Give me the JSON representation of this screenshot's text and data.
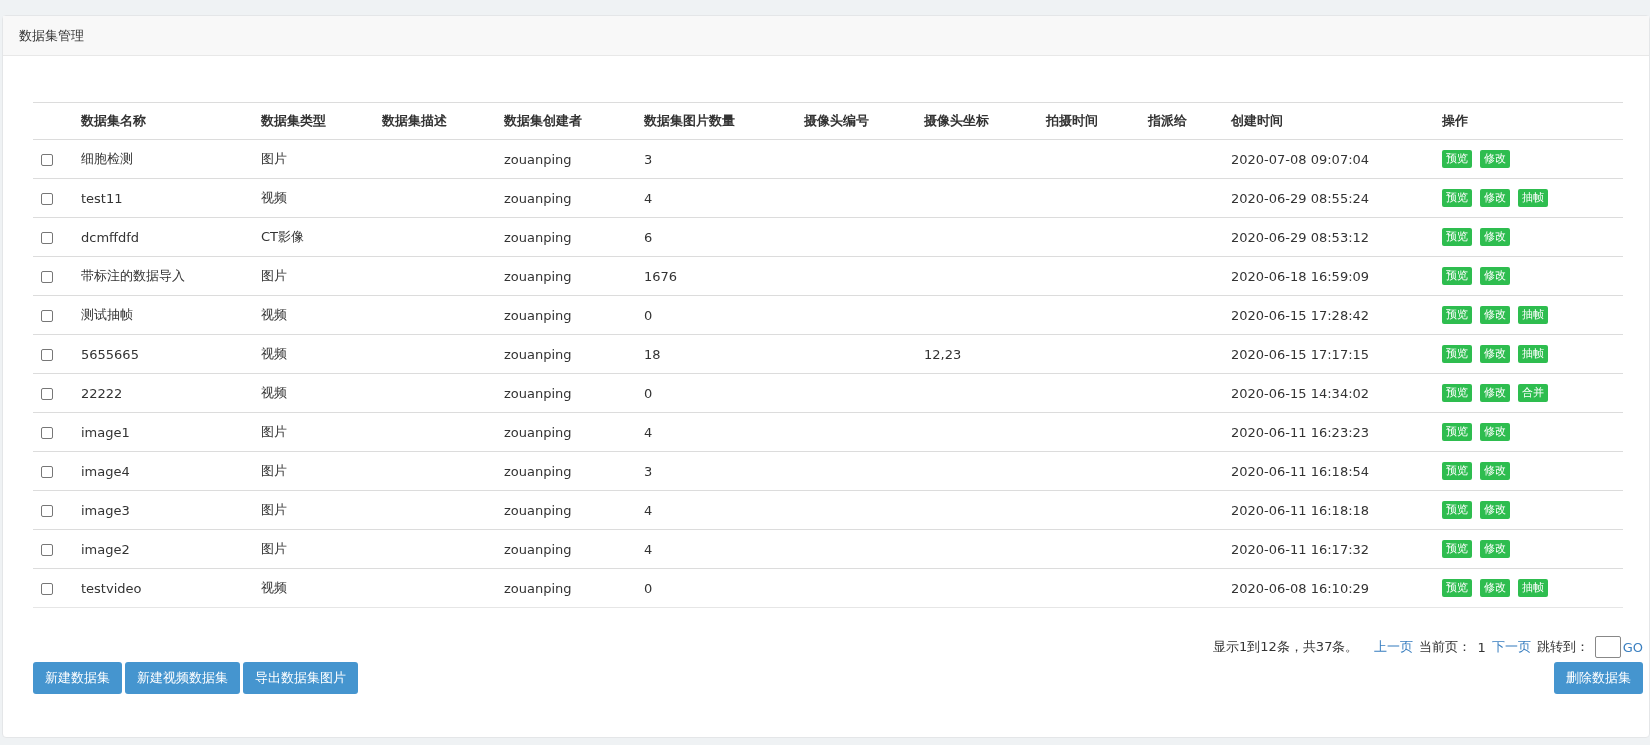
{
  "panel": {
    "title": "数据集管理"
  },
  "table": {
    "columns": [
      "数据集名称",
      "数据集类型",
      "数据集描述",
      "数据集创建者",
      "数据集图片数量",
      "摄像头编号",
      "摄像头坐标",
      "拍摄时间",
      "指派给",
      "创建时间",
      "操作"
    ],
    "rows": [
      {
        "checked": false,
        "cells": [
          "细胞检测",
          "图片",
          "",
          "zouanping",
          "3",
          "",
          "",
          "",
          "",
          "2020-07-08 09:07:04"
        ],
        "actions": [
          "预览",
          "修改"
        ]
      },
      {
        "checked": false,
        "cells": [
          "test11",
          "视频",
          "",
          "zouanping",
          "4",
          "",
          "",
          "",
          "",
          "2020-06-29 08:55:24"
        ],
        "actions": [
          "预览",
          "修改",
          "抽帧"
        ]
      },
      {
        "checked": false,
        "cells": [
          "dcmffdfd",
          "CT影像",
          "",
          "zouanping",
          "6",
          "",
          "",
          "",
          "",
          "2020-06-29 08:53:12"
        ],
        "actions": [
          "预览",
          "修改"
        ]
      },
      {
        "checked": false,
        "cells": [
          "带标注的数据导入",
          "图片",
          "",
          "zouanping",
          "1676",
          "",
          "",
          "",
          "",
          "2020-06-18 16:59:09"
        ],
        "actions": [
          "预览",
          "修改"
        ]
      },
      {
        "checked": false,
        "cells": [
          "测试抽帧",
          "视频",
          "",
          "zouanping",
          "0",
          "",
          "",
          "",
          "",
          "2020-06-15 17:28:42"
        ],
        "actions": [
          "预览",
          "修改",
          "抽帧"
        ]
      },
      {
        "checked": false,
        "cells": [
          "5655665",
          "视频",
          "",
          "zouanping",
          "18",
          "",
          "12,23",
          "",
          "",
          "2020-06-15 17:17:15"
        ],
        "actions": [
          "预览",
          "修改",
          "抽帧"
        ]
      },
      {
        "checked": false,
        "cells": [
          "22222",
          "视频",
          "",
          "zouanping",
          "0",
          "",
          "",
          "",
          "",
          "2020-06-15 14:34:02"
        ],
        "actions": [
          "预览",
          "修改",
          "合并"
        ]
      },
      {
        "checked": false,
        "cells": [
          "image1",
          "图片",
          "",
          "zouanping",
          "4",
          "",
          "",
          "",
          "",
          "2020-06-11 16:23:23"
        ],
        "actions": [
          "预览",
          "修改"
        ]
      },
      {
        "checked": false,
        "cells": [
          "image4",
          "图片",
          "",
          "zouanping",
          "3",
          "",
          "",
          "",
          "",
          "2020-06-11 16:18:54"
        ],
        "actions": [
          "预览",
          "修改"
        ]
      },
      {
        "checked": false,
        "cells": [
          "image3",
          "图片",
          "",
          "zouanping",
          "4",
          "",
          "",
          "",
          "",
          "2020-06-11 16:18:18"
        ],
        "actions": [
          "预览",
          "修改"
        ]
      },
      {
        "checked": false,
        "cells": [
          "image2",
          "图片",
          "",
          "zouanping",
          "4",
          "",
          "",
          "",
          "",
          "2020-06-11 16:17:32"
        ],
        "actions": [
          "预览",
          "修改"
        ]
      },
      {
        "checked": false,
        "cells": [
          "testvideo",
          "视频",
          "",
          "zouanping",
          "0",
          "",
          "",
          "",
          "",
          "2020-06-08 16:10:29"
        ],
        "actions": [
          "预览",
          "修改",
          "抽帧"
        ]
      }
    ]
  },
  "pager": {
    "summary": "显示1到12条，共37条。",
    "prev": "上一页",
    "current_label": "当前页：",
    "current": "1",
    "next": "下一页",
    "jump_label": "跳转到：",
    "go": "GO"
  },
  "buttons": [
    "新建数据集",
    "新建视频数据集",
    "导出数据集图片"
  ],
  "delete_button": "删除数据集"
}
